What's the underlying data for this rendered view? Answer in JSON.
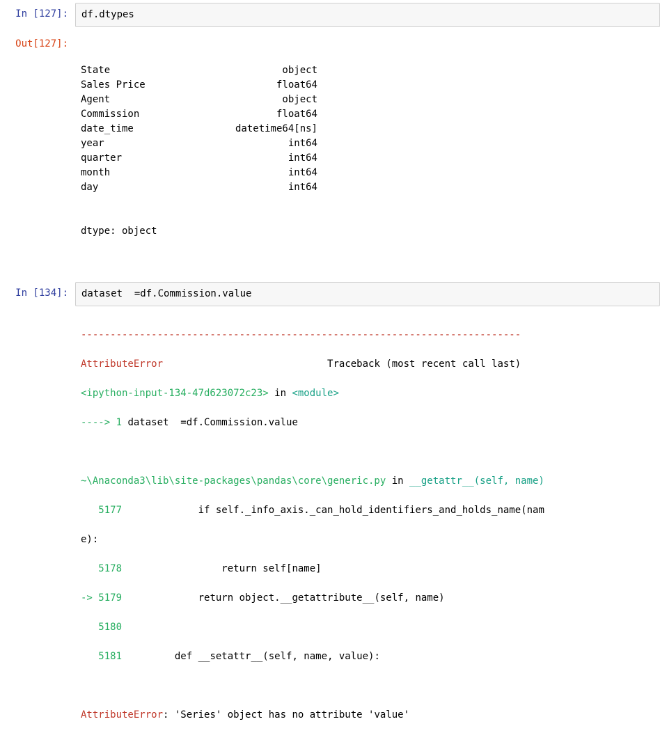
{
  "cell1": {
    "inPrompt": "In [127]:",
    "code": "df.dtypes"
  },
  "cell1out": {
    "outPrompt": "Out[127]:",
    "rows": [
      {
        "name": "State",
        "type": "object"
      },
      {
        "name": "Sales Price",
        "type": "float64"
      },
      {
        "name": "Agent",
        "type": "object"
      },
      {
        "name": "Commission",
        "type": "float64"
      },
      {
        "name": "date_time",
        "type": "datetime64[ns]"
      },
      {
        "name": "year",
        "type": "int64"
      },
      {
        "name": "quarter",
        "type": "int64"
      },
      {
        "name": "month",
        "type": "int64"
      },
      {
        "name": "day",
        "type": "int64"
      }
    ],
    "footer": "dtype: object"
  },
  "cell2": {
    "inPrompt": "In [134]:",
    "code": "dataset  =df.Commission.value"
  },
  "tb": {
    "hr": "---------------------------------------------------------------------------",
    "errName": "AttributeError",
    "tbLabel": "Traceback (most recent call last)",
    "loc1a": "<ipython-input-134-47d623072c23>",
    "loc1b": " in ",
    "loc1c": "<module>",
    "arrow1": "----> 1",
    "l1": " dataset  =df.Commission.value",
    "loc2a": "~\\Anaconda3\\lib\\site-packages\\pandas\\core\\generic.py",
    "loc2b": " in ",
    "loc2c": "__getattr__",
    "loc2d": "(self, name)",
    "n5177": "   5177",
    "l5177a": "             if self._info_axis._can_hold_identifiers_and_holds_name(nam",
    "l5177b": "e):",
    "n5178": "   5178",
    "l5178": "                 return self[name]",
    "arrow5179": "-> 5179",
    "l5179": "             return object.__getattribute__(self, name)",
    "n5180": "   5180",
    "n5181": "   5181",
    "l5181": "         def __setattr__(self, name, value):",
    "finalErr": "AttributeError",
    "finalMsg": ": 'Series' object has no attribute 'value'"
  }
}
